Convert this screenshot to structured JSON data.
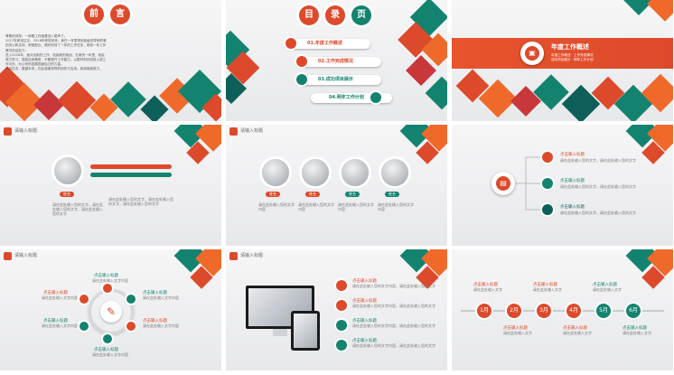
{
  "slide1": {
    "title_chars": [
      "前",
      "言"
    ],
    "paragraphs": [
      "尊敬的领导：一转眼工作就要进入尾声了。",
      "2017年即将过去，2018年即将到来。我在一年里得到各级领导和同事的关心和支持，积极配合，顺利完成了一年的工作任务，现将一年工作情况总结如下。",
      "进入2018年，面对全新的工作，迎接新的挑战，在新的一年里，我会努力学习，提高自身素质，不断提升工作能力，以更好的状态投入到工作中去，为公司的发展贡献自己的力量。",
      "总结过去，展望未来，在此感谢领导的信任与支持，我将继续努力。"
    ]
  },
  "slide2": {
    "title_chars": [
      "目",
      "录",
      "页"
    ],
    "items": [
      {
        "label": "01.年度工作概述",
        "color": "#dd4a2b"
      },
      {
        "label": "02.工作完成情况",
        "color": "#dd4a2b"
      },
      {
        "label": "03.成功项目展示",
        "color": "#13836f"
      },
      {
        "label": "04.明年工作计划",
        "color": "#13836f"
      }
    ]
  },
  "slide3": {
    "title": "年度工作概述",
    "points": [
      "年度工作概述",
      "工作完成情况",
      "成功项目展示",
      "明年工作计划"
    ]
  },
  "header_title": "请输入标题",
  "slide4": {
    "name": "姓名",
    "desc": "请在此处输入您的文字，请在此处输入您的文字，请在此处输入您的文字"
  },
  "slide5": {
    "names": [
      "姓名",
      "姓名",
      "姓名",
      "姓名"
    ],
    "desc": "请在此处输入您的文字内容"
  },
  "slide6": {
    "items": [
      {
        "title": "点击输入标题",
        "desc": "请在此处输入您的文字，请在此处输入您的文字"
      },
      {
        "title": "点击输入标题",
        "desc": "请在此处输入您的文字，请在此处输入您的文字"
      },
      {
        "title": "点击输入标题",
        "desc": "请在此处输入您的文字，请在此处输入您的文字"
      }
    ]
  },
  "slide7": {
    "items": [
      {
        "title": "点击输入标题",
        "desc": "请在此处输入文字内容"
      },
      {
        "title": "点击输入标题",
        "desc": "请在此处输入文字内容"
      },
      {
        "title": "点击输入标题",
        "desc": "请在此处输入文字内容"
      },
      {
        "title": "点击输入标题",
        "desc": "请在此处输入文字内容"
      },
      {
        "title": "点击输入标题",
        "desc": "请在此处输入文字内容"
      },
      {
        "title": "点击输入标题",
        "desc": "请在此处输入文字内容"
      }
    ]
  },
  "slide8": {
    "items": [
      {
        "title": "点击输入标题",
        "desc": "请在此处输入您的文字内容，请在此处输入您的文字"
      },
      {
        "title": "点击输入标题",
        "desc": "请在此处输入您的文字内容，请在此处输入您的文字"
      },
      {
        "title": "点击输入标题",
        "desc": "请在此处输入您的文字内容，请在此处输入您的文字"
      },
      {
        "title": "点击输入标题",
        "desc": "请在此处输入您的文字内容，请在此处输入您的文字"
      }
    ]
  },
  "slide9": {
    "months": [
      "1月",
      "2月",
      "3月",
      "4月",
      "5月",
      "6月"
    ],
    "item_title": "点击输入标题",
    "item_desc": "请在此处输入文字"
  },
  "colors": {
    "red": "#dd4a2b",
    "orange": "#ef6a2a",
    "teal": "#13836f",
    "dark_teal": "#0e5f5a"
  }
}
